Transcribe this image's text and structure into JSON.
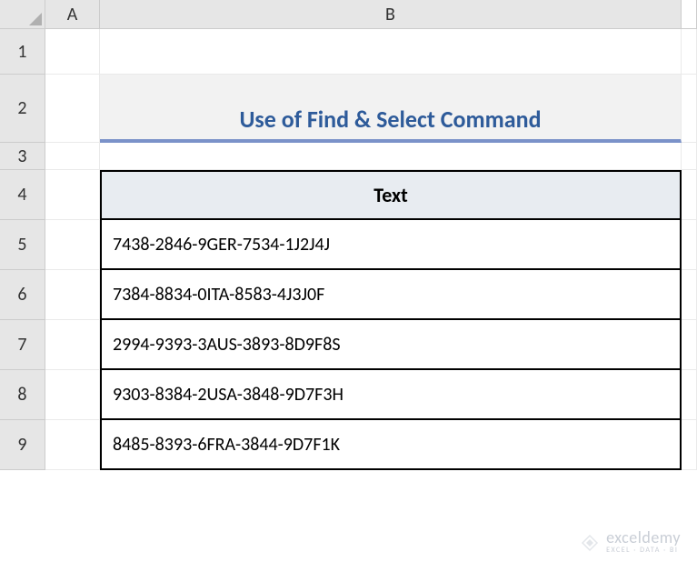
{
  "columns": [
    "A",
    "B"
  ],
  "rows": [
    "1",
    "2",
    "3",
    "4",
    "5",
    "6",
    "7",
    "8",
    "9"
  ],
  "title": "Use of Find & Select Command",
  "table": {
    "header": "Text",
    "values": [
      "7438-2846-9GER-7534-1J2J4J",
      "7384-8834-0ITA-8583-4J3J0F",
      "2994-9393-3AUS-3893-8D9F8S",
      "9303-8384-2USA-3848-9D7F3H",
      "8485-8393-6FRA-3844-9D7F1K"
    ]
  },
  "watermark": {
    "brand": "exceldemy",
    "tagline": "EXCEL · DATA · BI"
  }
}
